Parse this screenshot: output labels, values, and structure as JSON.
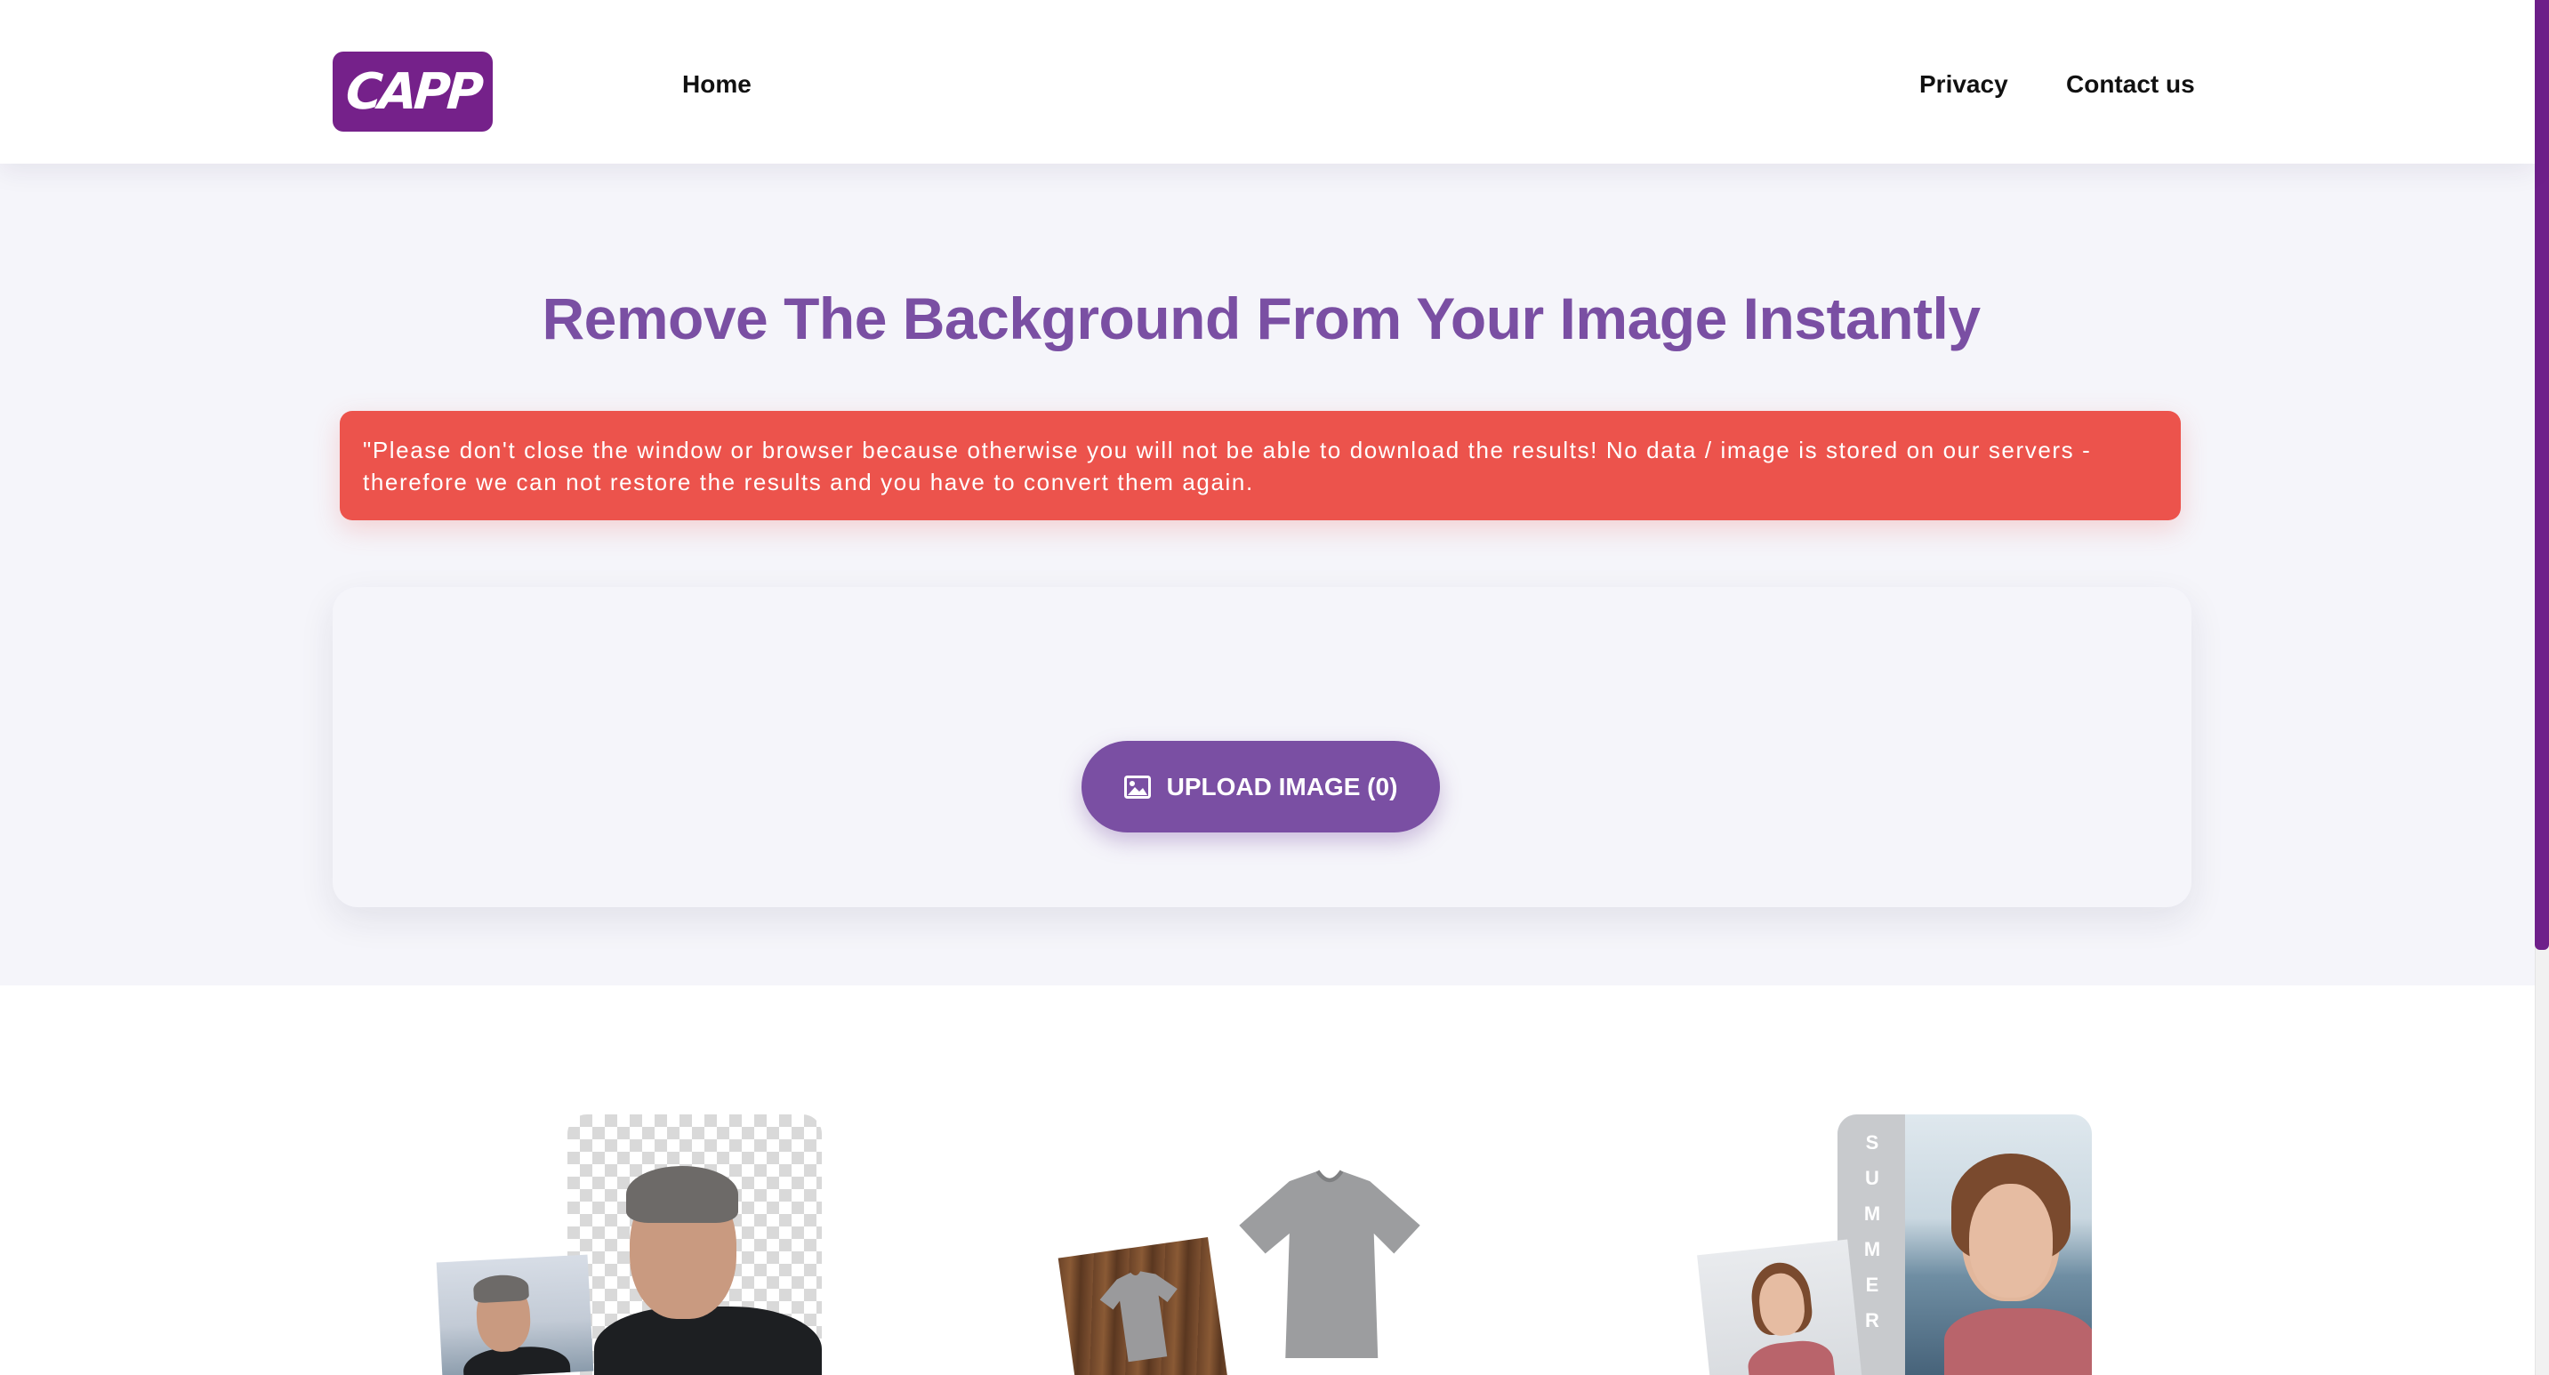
{
  "nav": {
    "logo_text": "CAPP",
    "home": "Home",
    "privacy": "Privacy",
    "contact": "Contact us"
  },
  "hero": {
    "title": "Remove The Background From Your Image Instantly",
    "notice": "\"Please don't close the window or browser because otherwise you will not be able to download the results! No data / image is stored on our servers - therefore we can not restore the results and you have to convert them again.",
    "upload_label": "UPLOAD IMAGE (0)"
  },
  "examples": {
    "summer_letters": [
      "S",
      "U",
      "M",
      "M",
      "E",
      "R"
    ]
  },
  "colors": {
    "brand": "#75218a",
    "accent": "#7a4fa3",
    "notice": "#ec534c",
    "hero_bg": "#f5f5fa"
  },
  "icons": {
    "upload": "image-icon"
  }
}
